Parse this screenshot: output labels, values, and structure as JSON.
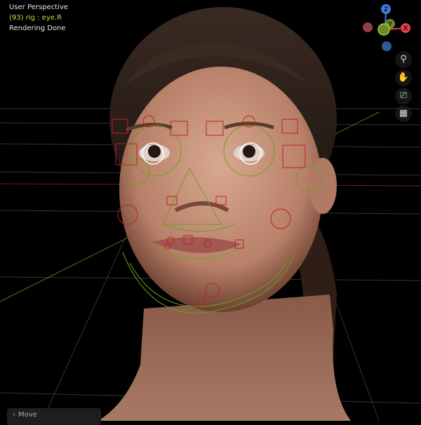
{
  "overlay": {
    "view": "User Perspective",
    "object": "(93) rig : eye.R",
    "status": "Rendering Done"
  },
  "gizmo": {
    "z": "Z",
    "y": "Y",
    "x": "X",
    "colors": {
      "x": "#e04050",
      "y": "#8aa82a",
      "z": "#3f7fe0"
    }
  },
  "nav_icons": [
    "zoom-icon",
    "hand-icon",
    "camera-icon",
    "grid-icon"
  ],
  "panel": {
    "label": "Move"
  }
}
